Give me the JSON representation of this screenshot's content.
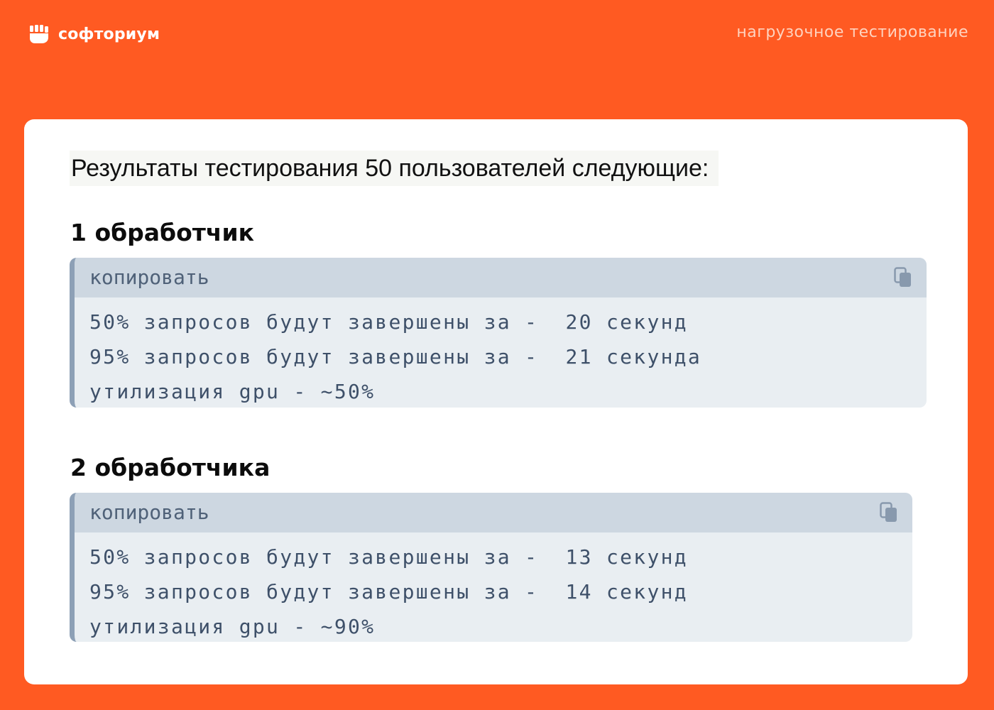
{
  "brand": {
    "name": "софториум",
    "icon": "fist-logo-icon"
  },
  "tagline": "нагрузочное тестирование",
  "intro": "Результаты тестирования 50 пользователей следующие:",
  "sections": [
    {
      "heading": "1 обработчик",
      "copy_label": "копировать",
      "copy_icon": "copy-icon",
      "lines": [
        "50% запросов будут завершены за -  20 секунд",
        "95% запросов будут завершены за -  21 секунда",
        "утилизация gpu - ~50%"
      ]
    },
    {
      "heading": "2 обработчика",
      "copy_label": "копировать",
      "copy_icon": "copy-icon",
      "lines": [
        "50% запросов будут завершены за -  13 секунд",
        "95% запросов будут завершены за -  14 секунд",
        "утилизация gpu - ~90%"
      ]
    }
  ],
  "colors": {
    "accent": "#ff5a22",
    "code_background": "#e9eef2",
    "code_header": "#cdd7e1",
    "code_text": "#3e5069"
  }
}
